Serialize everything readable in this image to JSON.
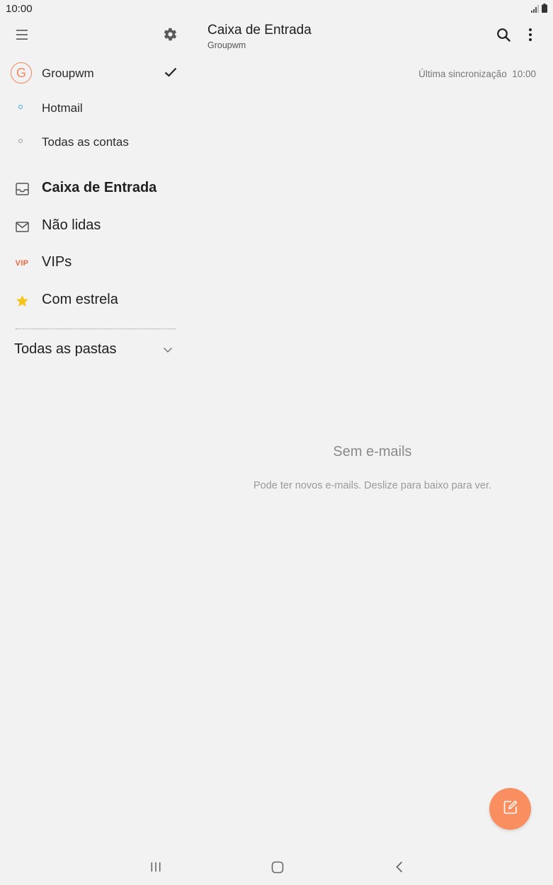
{
  "status_bar": {
    "time": "10:00",
    "icons": [
      "signal-icon",
      "battery-icon"
    ]
  },
  "drawer": {
    "icons": {
      "menu": "menu-icon",
      "settings": "gear-icon"
    },
    "accounts": [
      {
        "label": "Groupwm",
        "avatar_letter": "G",
        "selected": true,
        "color": "#f0875c"
      },
      {
        "label": "Hotmail",
        "color": "#3aa8d8"
      },
      {
        "label": "Todas as contas",
        "color": "#9a9a9a"
      }
    ],
    "folders": [
      {
        "label": "Caixa de Entrada",
        "icon": "inbox-icon",
        "active": true
      },
      {
        "label": "Não lidas",
        "icon": "envelope-icon"
      },
      {
        "label": "VIPs",
        "icon_text": "VIP",
        "color": "#e8673a"
      },
      {
        "label": "Com estrela",
        "icon": "star-icon",
        "color": "#f5c518"
      }
    ],
    "all_folders_label": "Todas as pastas"
  },
  "main": {
    "title": "Caixa de Entrada",
    "subtitle": "Groupwm",
    "sync_text": "Última sincronização  10:00",
    "empty_title": "Sem e-mails",
    "empty_subtitle": "Pode ter novos e-mails. Deslize para baixo para ver.",
    "fab_color": "#f98e60"
  },
  "nav_bar": {
    "icons": [
      "recents-icon",
      "home-icon",
      "back-icon"
    ]
  }
}
